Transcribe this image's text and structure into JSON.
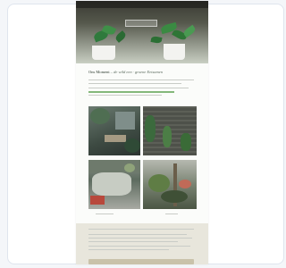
{
  "email": {
    "hero": {
      "preheader": "",
      "cta_label": ""
    },
    "heading": {
      "title": "Ons Moment",
      "subtitle": "– de wild een · groene Eetsamen"
    },
    "footer": {
      "title": ""
    }
  },
  "colors": {
    "card_border": "#dfe5ee",
    "page_bg": "#f4f6f9",
    "hero_dark": "#3a3a34",
    "accent_green": "#84b87a",
    "footer_bg": "#e8e6dc"
  }
}
